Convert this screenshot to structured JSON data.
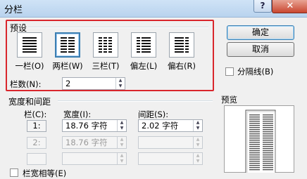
{
  "title": "分栏",
  "window_controls": {
    "help": "?",
    "close": "✕"
  },
  "presets": {
    "group_label": "预设",
    "items": [
      {
        "label": "一栏(O)",
        "icon": "one-column-icon"
      },
      {
        "label": "两栏(W)",
        "icon": "two-columns-icon"
      },
      {
        "label": "三栏(T)",
        "icon": "three-columns-icon"
      },
      {
        "label": "偏左(L)",
        "icon": "left-column-icon"
      },
      {
        "label": "偏右(R)",
        "icon": "right-column-icon"
      }
    ],
    "selected_index": 1
  },
  "column_count": {
    "label": "栏数(N):",
    "value": "2"
  },
  "width_spacing": {
    "group_label": "宽度和间距",
    "headers": {
      "column": "栏(C):",
      "width": "宽度(I):",
      "spacing": "间距(S):"
    },
    "rows": [
      {
        "num": "1:",
        "width": "18.76 字符",
        "spacing": "2.02 字符",
        "enabled": true
      },
      {
        "num": "2:",
        "width": "18.76 字符",
        "spacing": "",
        "enabled": false
      },
      {
        "num": "",
        "width": "",
        "spacing": "",
        "enabled": false
      }
    ],
    "equal_width_label": "栏宽相等(E)"
  },
  "buttons": {
    "ok": "确定",
    "cancel": "取消"
  },
  "separator_label": "分隔线(B)",
  "preview_label": "预览",
  "icons": {
    "help": "help-icon",
    "close": "close-icon",
    "spin_up": "chevron-up-icon",
    "spin_down": "chevron-down-icon"
  },
  "colors": {
    "highlight": "#d9262c",
    "selected_border": "#3c7fb1"
  }
}
